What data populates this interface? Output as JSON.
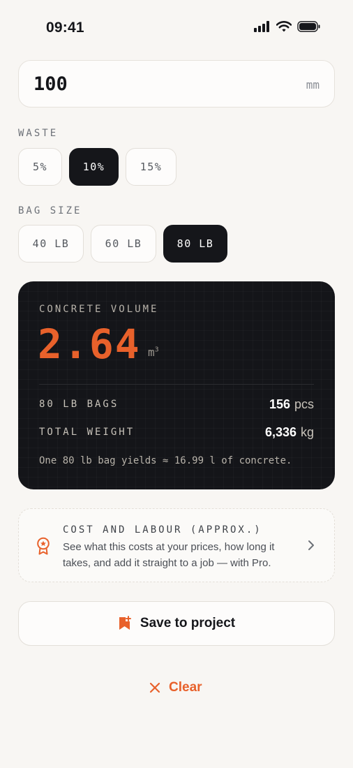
{
  "status_bar": {
    "time": "09:41",
    "icons": [
      "signal-icon",
      "wifi-icon",
      "battery-icon"
    ]
  },
  "thickness": {
    "value": "100",
    "unit": "mm"
  },
  "waste": {
    "label": "WASTE",
    "options": [
      "5%",
      "10%",
      "15%"
    ],
    "selected": "10%"
  },
  "bag_size": {
    "label": "BAG SIZE",
    "options": [
      "40 LB",
      "60 LB",
      "80 LB"
    ],
    "selected": "80 LB"
  },
  "result": {
    "label": "CONCRETE VOLUME",
    "volume": "2.64",
    "volume_unit": "m",
    "volume_unit_exp": "3",
    "bags_label": "80 LB BAGS",
    "bags_value": "156",
    "bags_unit": "pcs",
    "weight_label": "TOTAL WEIGHT",
    "weight_value": "6,336",
    "weight_unit": "kg",
    "note": "One 80 lb bag yields ≈ 16.99 l of concrete."
  },
  "pro": {
    "title": "COST AND LABOUR (APPROX.)",
    "description": "See what this costs at your prices, how long it takes, and add it straight to a job — with Pro.",
    "icon": "award-badge-icon"
  },
  "actions": {
    "save_label": "Save to project",
    "clear_label": "Clear"
  },
  "colors": {
    "accent": "#e8612b",
    "dark": "#15161a",
    "background": "#f8f6f3"
  }
}
